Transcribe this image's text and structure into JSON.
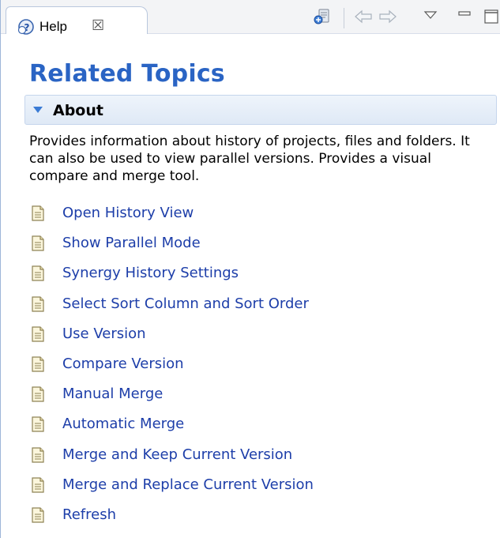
{
  "tab": {
    "label": "Help",
    "close_symbol": "☒"
  },
  "toolbar": {
    "icons": [
      "bookmark-icon",
      "back-arrow-icon",
      "forward-arrow-icon",
      "view-menu-icon",
      "minimize-icon",
      "maximize-icon"
    ]
  },
  "page": {
    "title": "Related Topics"
  },
  "section": {
    "label": "About",
    "description": "Provides information about history of projects, files and folders. It can also be used to view parallel versions. Provides a visual compare and merge tool."
  },
  "topics": [
    "Open History View",
    "Show Parallel Mode",
    "Synergy History Settings",
    "Select Sort Column and Sort Order",
    "Use Version",
    "Compare Version",
    "Manual Merge",
    "Automatic Merge",
    "Merge and Keep Current Version",
    "Merge and Replace Current Version",
    "Refresh"
  ],
  "colors": {
    "title": "#2a64c4",
    "link": "#1d3ea9",
    "header_bg": "#e6eef9"
  }
}
